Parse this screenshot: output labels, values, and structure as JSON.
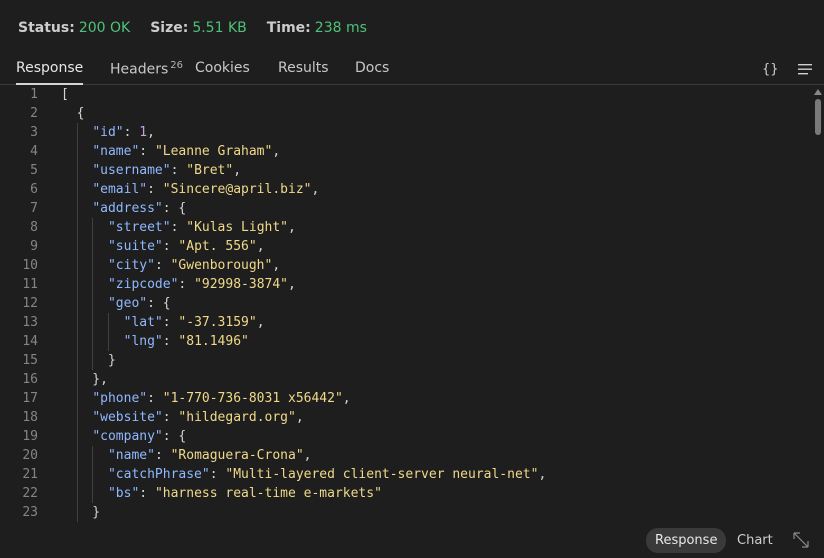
{
  "status": {
    "status_label": "Status:",
    "status_value": "200 OK",
    "size_label": "Size:",
    "size_value": "5.51 KB",
    "time_label": "Time:",
    "time_value": "238 ms"
  },
  "tabs": {
    "response": "Response",
    "headers": "Headers",
    "headers_count": "26",
    "cookies": "Cookies",
    "results": "Results",
    "docs": "Docs",
    "format_icon": "{}",
    "menu_icon": "hamburger-icon"
  },
  "code_lines": [
    "[",
    "  {",
    "    \"id\": 1,",
    "    \"name\": \"Leanne Graham\",",
    "    \"username\": \"Bret\",",
    "    \"email\": \"Sincere@april.biz\",",
    "    \"address\": {",
    "      \"street\": \"Kulas Light\",",
    "      \"suite\": \"Apt. 556\",",
    "      \"city\": \"Gwenborough\",",
    "      \"zipcode\": \"92998-3874\",",
    "      \"geo\": {",
    "        \"lat\": \"-37.3159\",",
    "        \"lng\": \"81.1496\"",
    "      }",
    "    },",
    "    \"phone\": \"1-770-736-8031 x56442\",",
    "    \"website\": \"hildegard.org\",",
    "    \"company\": {",
    "      \"name\": \"Romaguera-Crona\",",
    "      \"catchPhrase\": \"Multi-layered client-server neural-net\",",
    "      \"bs\": \"harness real-time e-markets\"",
    "    }"
  ],
  "bottom": {
    "response": "Response",
    "chart": "Chart",
    "expand_icon": "expand-icon"
  },
  "colors": {
    "status_green": "#4ec27a",
    "json_key": "#8fb8ff",
    "json_string": "#f0d98a",
    "json_number": "#c8a0e0"
  }
}
